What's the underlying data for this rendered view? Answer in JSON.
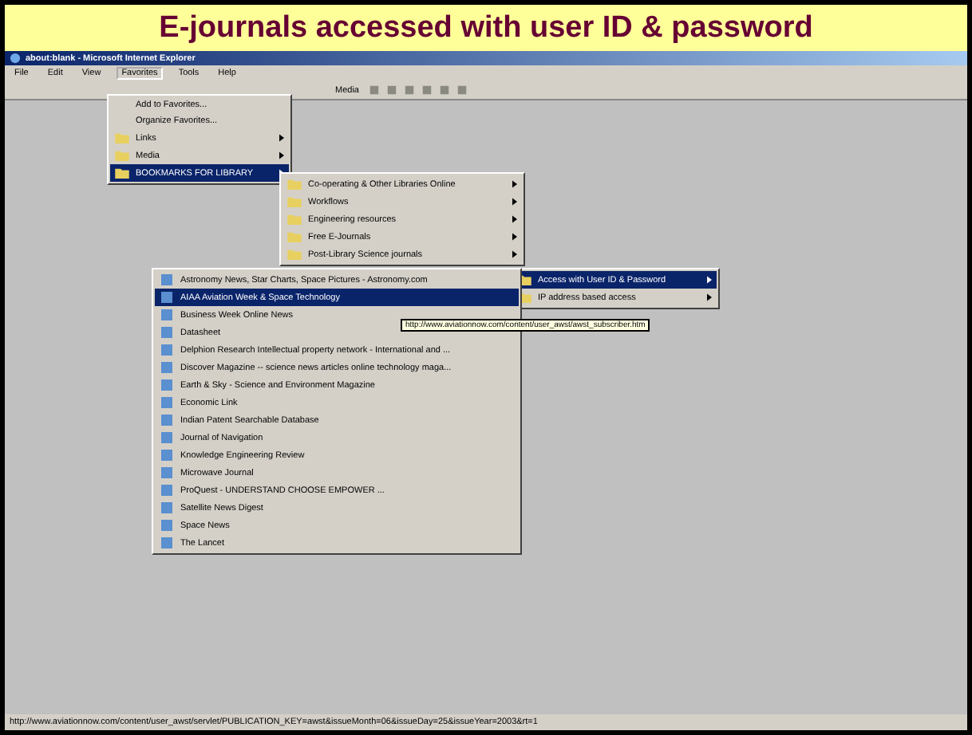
{
  "slide_title": "E-journals accessed with user ID & password",
  "window": {
    "title": "about:blank - Microsoft Internet Explorer"
  },
  "menu_bar": [
    {
      "label": "File",
      "selected": false
    },
    {
      "label": "Edit",
      "selected": false
    },
    {
      "label": "View",
      "selected": false
    },
    {
      "label": "Favorites",
      "selected": true
    },
    {
      "label": "Tools",
      "selected": false
    },
    {
      "label": "Help",
      "selected": false
    }
  ],
  "toolbar": {
    "media_label": "Media"
  },
  "favorites_menu": [
    {
      "label": "Add to Favorites...",
      "kind": "command",
      "selected": false
    },
    {
      "label": "Organize Favorites...",
      "kind": "command",
      "selected": false
    },
    {
      "label": "Links",
      "kind": "folder",
      "selected": false
    },
    {
      "label": "Media",
      "kind": "folder",
      "selected": false
    },
    {
      "label": "BOOKMARKS FOR LIBRARY",
      "kind": "folder",
      "selected": true
    }
  ],
  "library_menu": [
    {
      "label": "Co-operating & Other Libraries Online",
      "selected": false
    },
    {
      "label": "Workflows",
      "selected": false
    },
    {
      "label": "Engineering resources",
      "selected": false
    },
    {
      "label": "Free E-Journals",
      "selected": false
    },
    {
      "label": "Post-Library Science journals",
      "selected": false
    }
  ],
  "access_menu": [
    {
      "label": "Access with User ID & Password",
      "selected": true
    },
    {
      "label": "IP address based access",
      "selected": false
    }
  ],
  "journal_list": [
    {
      "label": "Astronomy News, Star Charts, Space Pictures - Astronomy.com",
      "selected": false
    },
    {
      "label": "AIAA Aviation Week & Space Technology",
      "selected": true
    },
    {
      "label": "Business Week Online News",
      "selected": false
    },
    {
      "label": "Datasheet",
      "selected": false
    },
    {
      "label": "Delphion Research Intellectual property network - International and ...",
      "selected": false
    },
    {
      "label": "Discover Magazine -- science news articles online technology maga...",
      "selected": false
    },
    {
      "label": "Earth & Sky - Science and Environment Magazine",
      "selected": false
    },
    {
      "label": "Economic Link",
      "selected": false
    },
    {
      "label": "Indian Patent Searchable Database",
      "selected": false
    },
    {
      "label": "Journal of Navigation",
      "selected": false
    },
    {
      "label": "Knowledge Engineering Review",
      "selected": false
    },
    {
      "label": "Microwave Journal",
      "selected": false
    },
    {
      "label": "ProQuest - UNDERSTAND CHOOSE EMPOWER ...",
      "selected": false
    },
    {
      "label": "Satellite News Digest",
      "selected": false
    },
    {
      "label": "Space News",
      "selected": false
    },
    {
      "label": "The Lancet",
      "selected": false
    }
  ],
  "tooltip": "http://www.aviationnow.com/content/user_awst/awst_subscriber.htm",
  "status_bar": "http://www.aviationnow.com/content/user_awst/servlet/PUBLICATION_KEY=awst&issueMonth=06&issueDay=25&issueYear=2003&rt=1"
}
